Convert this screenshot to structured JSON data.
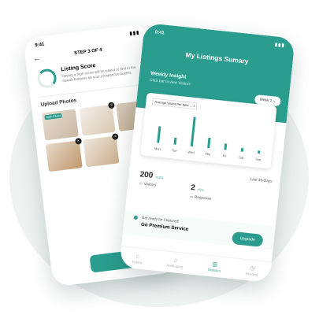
{
  "left_phone": {
    "time": "9:41",
    "step": "STEP 3 OF 4",
    "listing_score": {
      "title": "Listing Score",
      "text": "Having a high score will be easier to find in the search features by your prospective buyers."
    },
    "upload_title": "Upload Photos",
    "main_photo_badge": "Main Photo",
    "next_label": "Next",
    "photo_colors": [
      "#d9cfc3",
      "#eae4dc",
      "#c9b8a4",
      "#d8cdbd",
      "#e5d9c8"
    ]
  },
  "right_phone": {
    "time": "9:41",
    "title": "My Listings Sumary",
    "insight_title": "Weekly Insight",
    "insight_sub": "Click bar to view Visitors",
    "week_selector": "Week 2",
    "metric_select": "Average Visitor Per Wee",
    "metric_value": "3",
    "chart_data": {
      "type": "bar",
      "categories": [
        "Mon",
        "Tue",
        "Wed",
        "Thu",
        "Fri",
        "Sat",
        "Sun"
      ],
      "values": [
        48,
        20,
        85,
        30,
        18,
        10,
        8
      ],
      "ylim": [
        0,
        100
      ]
    },
    "period": "Last 30-Days",
    "stats": [
      {
        "value": "200",
        "pct": "+10%",
        "label": "Visitors"
      },
      {
        "value": "2",
        "pct": "+5%",
        "label": "Response"
      }
    ],
    "promo_pre": "Get ready for Featured!",
    "promo_main": "Go Premium Service",
    "upgrade_label": "Upgrade",
    "tabs": [
      {
        "label": "Listing",
        "icon": "home-icon"
      },
      {
        "label": "Notification",
        "icon": "bell-icon"
      },
      {
        "label": "Statistics",
        "icon": "chart-icon"
      },
      {
        "label": "Pending",
        "icon": "clock-icon"
      }
    ],
    "accent_color": "#2a9d8f"
  }
}
